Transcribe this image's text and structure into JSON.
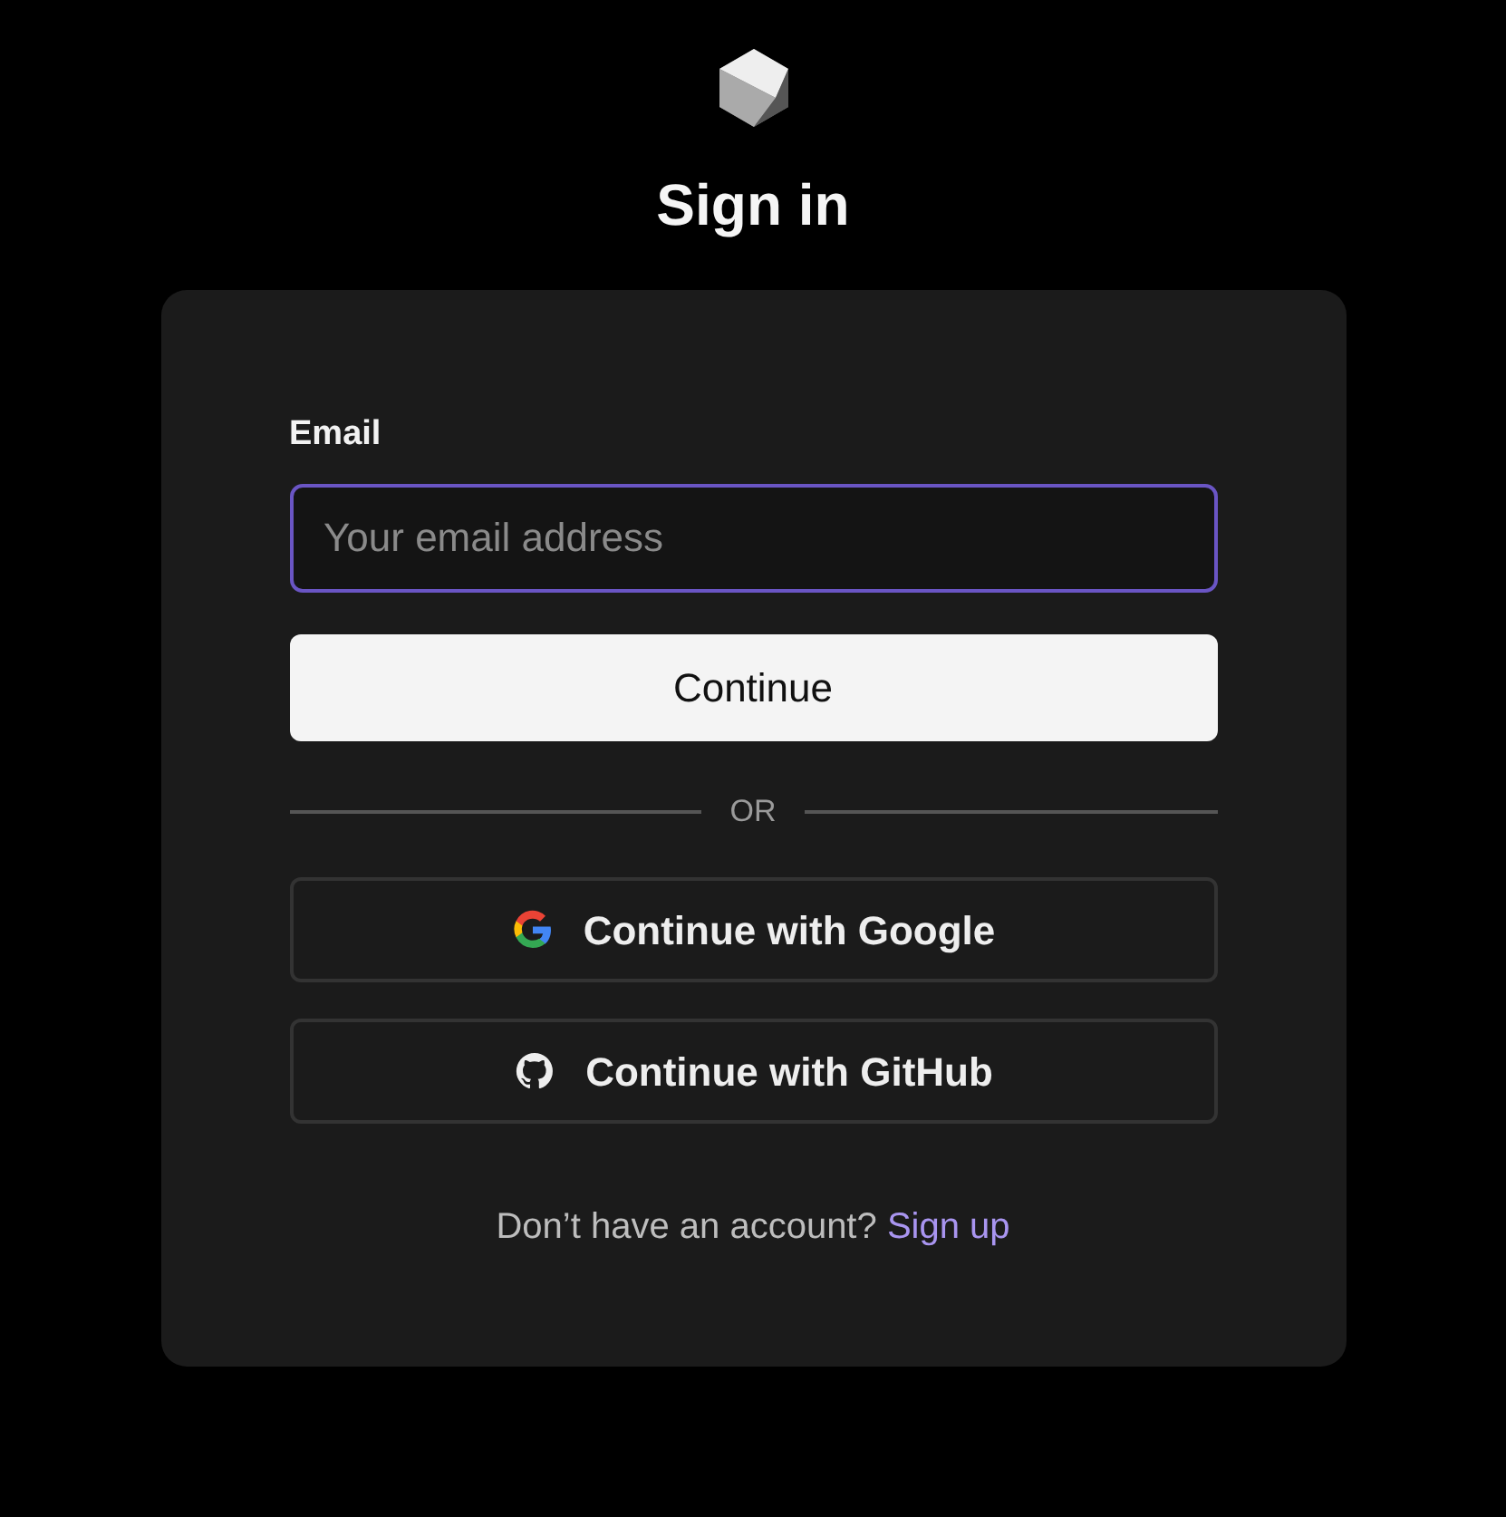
{
  "title": "Sign in",
  "email": {
    "label": "Email",
    "placeholder": "Your email address",
    "focused": true
  },
  "primary_button": "Continue",
  "divider": "OR",
  "social_buttons": [
    {
      "kind": "google",
      "label": "Continue with Google"
    },
    {
      "kind": "github",
      "label": "Continue with GitHub"
    }
  ],
  "footer": {
    "text": "Don’t have an account?",
    "link": "Sign up"
  }
}
